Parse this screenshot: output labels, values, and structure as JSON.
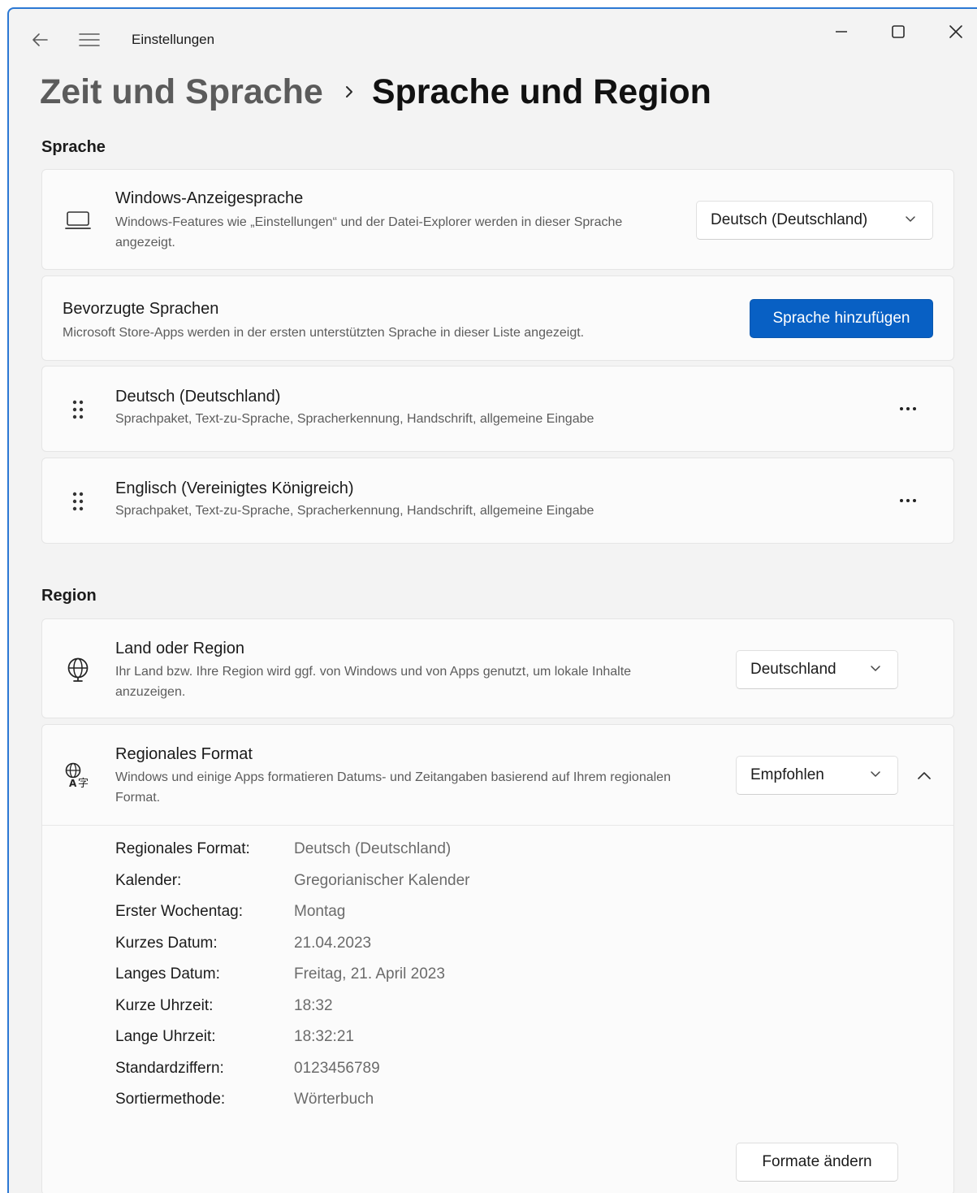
{
  "app": {
    "title": "Einstellungen",
    "accent_color": "#0860c4",
    "icons": {
      "back": "arrow-left-icon",
      "menu": "hamburger-icon",
      "minimize": "minimize-icon",
      "maximize": "maximize-icon",
      "close": "close-icon"
    }
  },
  "breadcrumb": {
    "parent": "Zeit und Sprache",
    "separator_icon": "chevron-right-icon",
    "current": "Sprache und Region"
  },
  "sprache": {
    "heading": "Sprache",
    "display_language": {
      "icon": "laptop-icon",
      "title": "Windows-Anzeigesprache",
      "description": "Windows-Features wie „Einstellungen“ und der Datei-Explorer werden in dieser Sprache angezeigt.",
      "selected": "Deutsch (Deutschland)"
    },
    "preferred": {
      "title": "Bevorzugte Sprachen",
      "description": "Microsoft Store-Apps werden in der ersten unterstützten Sprache in dieser Liste angezeigt.",
      "add_button": "Sprache hinzufügen"
    },
    "languages": [
      {
        "name": "Deutsch (Deutschland)",
        "features": "Sprachpaket, Text-zu-Sprache, Spracherkennung, Handschrift, allgemeine Eingabe"
      },
      {
        "name": "Englisch (Vereinigtes Königreich)",
        "features": "Sprachpaket, Text-zu-Sprache, Spracherkennung, Handschrift, allgemeine Eingabe"
      }
    ]
  },
  "region": {
    "heading": "Region",
    "country": {
      "icon": "globe-icon",
      "title": "Land oder Region",
      "description": "Ihr Land bzw. Ihre Region wird ggf. von Windows und von Apps genutzt, um lokale Inhalte anzuzeigen.",
      "selected": "Deutschland"
    },
    "format": {
      "icon": "language-format-icon",
      "title": "Regionales Format",
      "description": "Windows und einige Apps formatieren Datums- und Zeitangaben basierend auf Ihrem regionalen Format.",
      "selected": "Empfohlen",
      "expanded": true,
      "details": [
        {
          "label": "Regionales Format:",
          "value": "Deutsch (Deutschland)"
        },
        {
          "label": "Kalender:",
          "value": "Gregorianischer Kalender"
        },
        {
          "label": "Erster Wochentag:",
          "value": "Montag"
        },
        {
          "label": "Kurzes Datum:",
          "value": "21.04.2023"
        },
        {
          "label": "Langes Datum:",
          "value": "Freitag, 21. April 2023"
        },
        {
          "label": "Kurze Uhrzeit:",
          "value": "18:32"
        },
        {
          "label": "Lange Uhrzeit:",
          "value": "18:32:21"
        },
        {
          "label": "Standardziffern:",
          "value": "0123456789"
        },
        {
          "label": "Sortiermethode:",
          "value": "Wörterbuch"
        }
      ],
      "change_button": "Formate ändern"
    }
  }
}
